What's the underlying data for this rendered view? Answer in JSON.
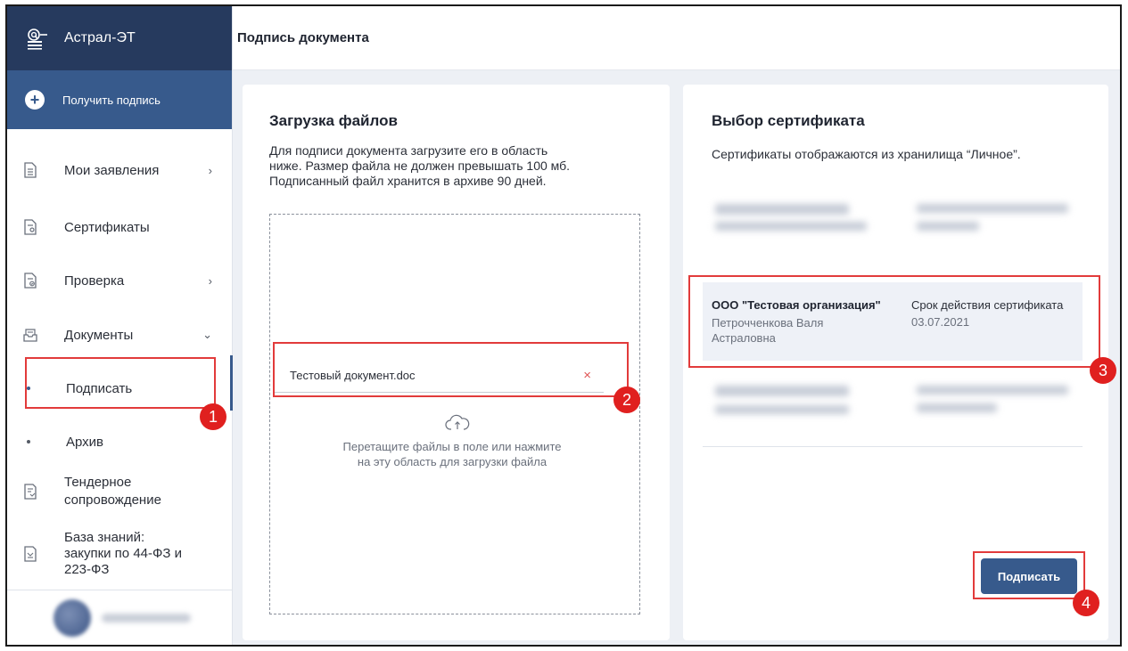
{
  "app": {
    "name": "Астрал-ЭТ"
  },
  "sidebar": {
    "cta_label": "Получить подпись",
    "items": [
      {
        "label": "Мои заявления",
        "chevron": "›"
      },
      {
        "label": "Сертификаты"
      },
      {
        "label": "Проверка",
        "chevron": "›"
      },
      {
        "label": "Документы",
        "chevron": "⌄"
      },
      {
        "label": "Подписать",
        "active": true
      },
      {
        "label": "Архив"
      },
      {
        "label_line1": "Тендерное",
        "label_line2": "сопровождение"
      },
      {
        "label_line1": "База знаний:",
        "label_line2": "закупки по 44-ФЗ и",
        "label_line3": "223-ФЗ"
      }
    ]
  },
  "header": {
    "title": "Подпись документа"
  },
  "upload": {
    "title": "Загрузка файлов",
    "desc_line1": "Для подписи документа загрузите его в область",
    "desc_line2": "ниже. Размер файла не должен превышать 100 мб.",
    "desc_line3": "Подписанный файл хранится в архиве 90 дней.",
    "file_name": "Тестовый документ.doc",
    "remove_icon": "×",
    "hint_line1": "Перетащите файлы в поле или нажмите",
    "hint_line2": "на эту область для загрузки файла"
  },
  "certs": {
    "title": "Выбор сертификата",
    "desc": "Сертификаты отображаются из хранилища “Личное”.",
    "selected": {
      "org": "ООО \"Тестовая организация\"",
      "owner_line1": "Петрочченкова Валя",
      "owner_line2": "Астраловна",
      "validity_label": "Срок действия сертификата",
      "validity_date": "03.07.2021"
    },
    "sign_button": "Подписать"
  },
  "annotations": [
    "1",
    "2",
    "3",
    "4"
  ],
  "colors": {
    "brand_dark": "#263a5e",
    "brand": "#375a8c",
    "annotation": "#e23b3b"
  }
}
